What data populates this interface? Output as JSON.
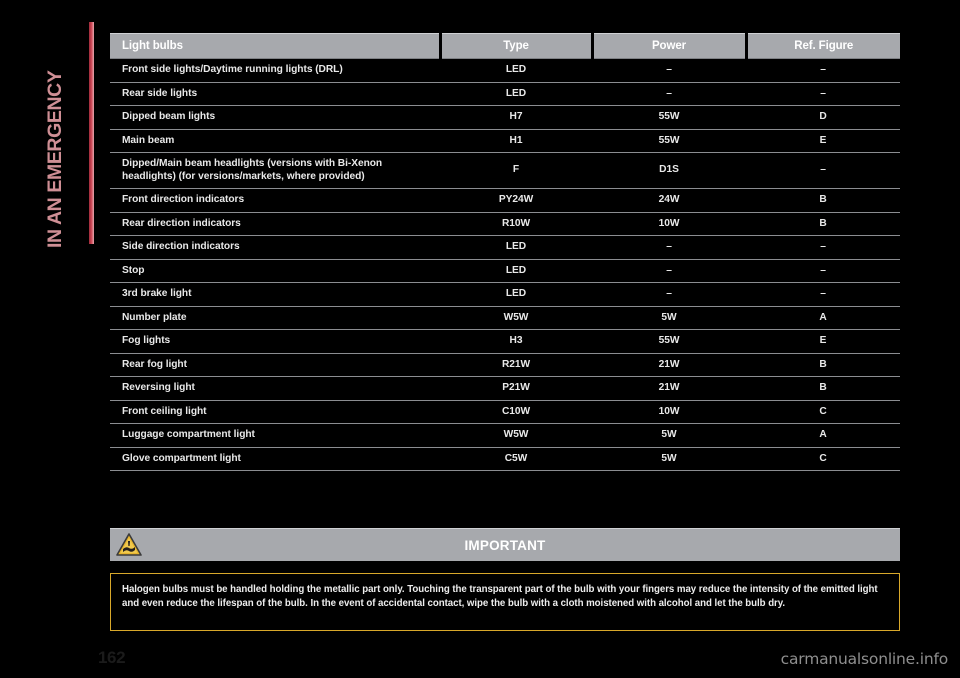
{
  "section_tab": {
    "label": "IN AN EMERGENCY",
    "accent_color": "#c9414f",
    "text_color": "#cf8f95"
  },
  "table": {
    "headers": {
      "name": "Light bulbs",
      "type": "Type",
      "power": "Power",
      "ref": "Ref. Figure"
    },
    "rows": [
      {
        "name": "Front side lights/Daytime running lights (DRL)",
        "type": "LED",
        "power": "–",
        "ref": "–"
      },
      {
        "name": "Rear side lights",
        "type": "LED",
        "power": "–",
        "ref": "–"
      },
      {
        "name": "Dipped beam lights",
        "type": "H7",
        "power": "55W",
        "ref": "D"
      },
      {
        "name": "Main beam",
        "type": "H1",
        "power": "55W",
        "ref": "E"
      },
      {
        "name": "Dipped/Main beam headlights (versions with Bi-Xenon headlights) (for versions/markets, where provided)",
        "type": "F",
        "power": "D1S",
        "ref": "–"
      },
      {
        "name": "Front direction indicators",
        "type": "PY24W",
        "power": "24W",
        "ref": "B"
      },
      {
        "name": "Rear direction indicators",
        "type": "R10W",
        "power": "10W",
        "ref": "B"
      },
      {
        "name": "Side direction indicators",
        "type": "LED",
        "power": "–",
        "ref": "–"
      },
      {
        "name": "Stop",
        "type": "LED",
        "power": "–",
        "ref": "–"
      },
      {
        "name": "3rd brake light",
        "type": "LED",
        "power": "–",
        "ref": "–"
      },
      {
        "name": "Number plate",
        "type": "W5W",
        "power": "5W",
        "ref": "A"
      },
      {
        "name": "Fog lights",
        "type": "H3",
        "power": "55W",
        "ref": "E"
      },
      {
        "name": "Rear fog light",
        "type": "R21W",
        "power": "21W",
        "ref": "B"
      },
      {
        "name": "Reversing light",
        "type": "P21W",
        "power": "21W",
        "ref": "B"
      },
      {
        "name": "Front ceiling light",
        "type": "C10W",
        "power": "10W",
        "ref": "C"
      },
      {
        "name": "Luggage compartment light",
        "type": "W5W",
        "power": "5W",
        "ref": "A"
      },
      {
        "name": "Glove compartment light",
        "type": "C5W",
        "power": "5W",
        "ref": "C"
      }
    ]
  },
  "important": {
    "title": "IMPORTANT",
    "icon": "warning-triangle-icon",
    "border_color": "#d8a82a",
    "body": "Halogen bulbs must be handled holding the metallic part only. Touching the transparent part of the bulb with your fingers may reduce the intensity of the emitted light and even reduce the lifespan of the bulb. In the event of accidental contact, wipe the bulb with a cloth moistened with alcohol and let the bulb dry."
  },
  "footer": {
    "page_number": "162",
    "watermark": "carmanualsonline.info"
  }
}
